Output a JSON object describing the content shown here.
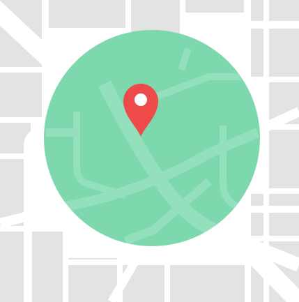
{
  "map": {
    "colors": {
      "background": "#ffffff",
      "block_fill": "#e3e3e3",
      "road": "#ffffff",
      "radius_area": "#76d6aa",
      "radius_area_opacity": 0.95,
      "pin": "#ef4a4a",
      "pin_hole": "#ffffff"
    },
    "icons": {
      "pin": "map-pin-icon",
      "radius": "search-radius-circle"
    }
  }
}
